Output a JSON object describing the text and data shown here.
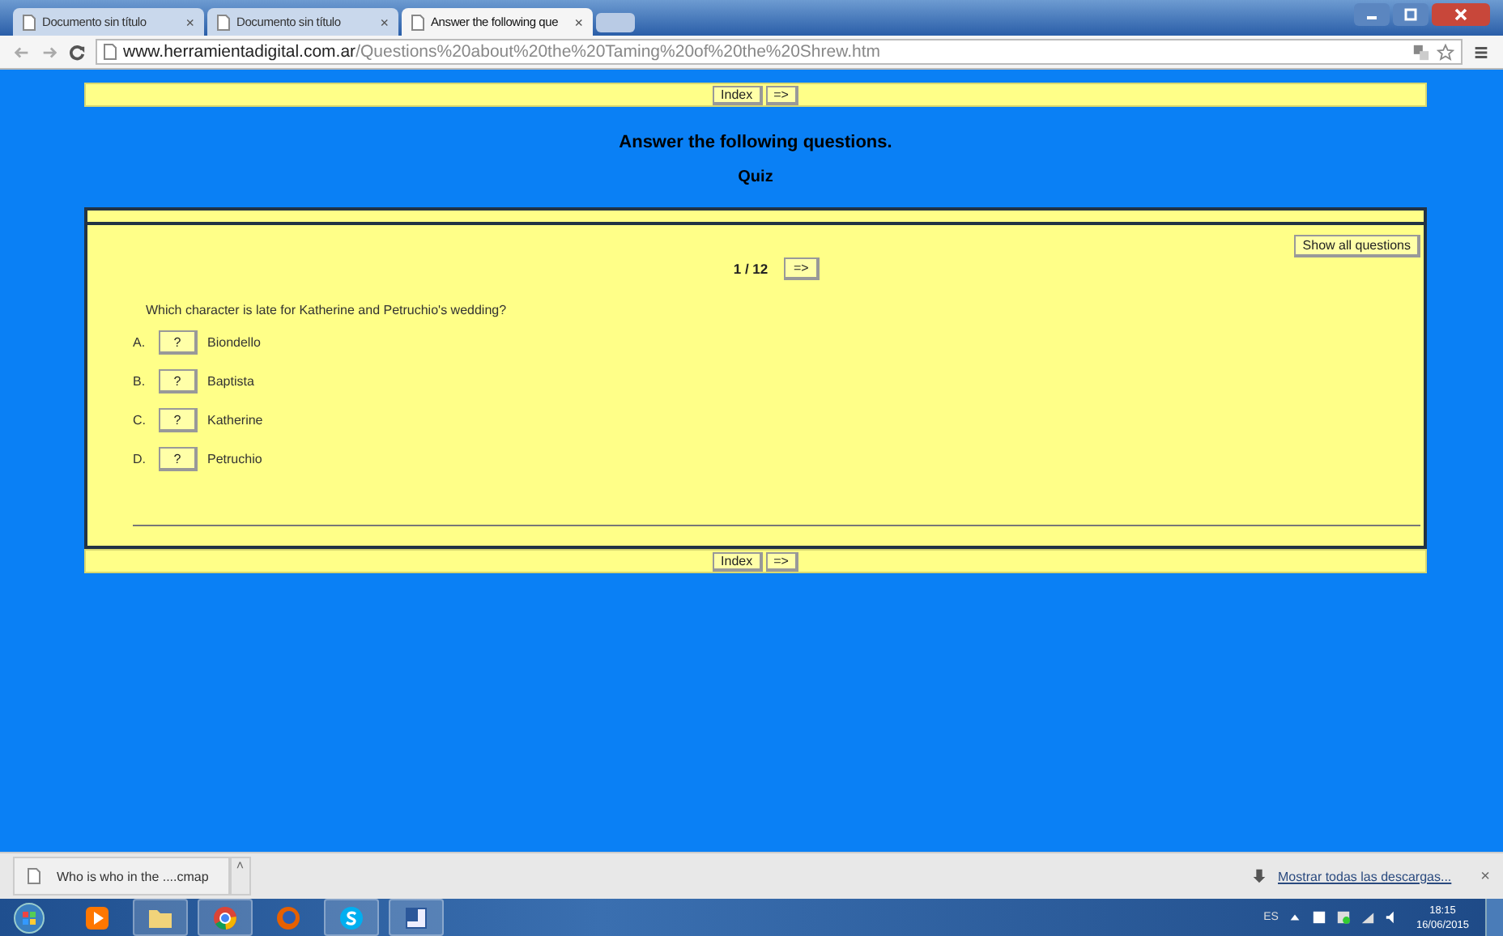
{
  "browser": {
    "tabs": [
      {
        "title": "Documento sin título",
        "close": "×",
        "selected": false
      },
      {
        "title": "Documento sin título",
        "close": "×",
        "selected": false
      },
      {
        "title": "Answer the following que",
        "close": "×",
        "selected": true
      }
    ],
    "url_host": "www.herramientadigital.com.ar",
    "url_path": "/Questions%20about%20the%20Taming%20of%20the%20Shrew.htm"
  },
  "nav_top": {
    "index": "Index",
    "next": "=>"
  },
  "heading": "Answer the following questions.",
  "subheading": "Quiz",
  "quiz": {
    "show_all": "Show all questions",
    "counter": "1 / 12",
    "next": "=>",
    "question": "Which character is late for Katherine and Petruchio's wedding?",
    "answers": [
      {
        "letter": "A.",
        "hint": "?",
        "text": "Biondello"
      },
      {
        "letter": "B.",
        "hint": "?",
        "text": "Baptista"
      },
      {
        "letter": "C.",
        "hint": "?",
        "text": "Katherine"
      },
      {
        "letter": "D.",
        "hint": "?",
        "text": "Petruchio"
      }
    ]
  },
  "nav_bottom": {
    "index": "Index",
    "next": "=>"
  },
  "download_bar": {
    "file": "Who is who in the ....cmap",
    "caret": "˄",
    "show_all": "Mostrar todas las descargas...",
    "close": "×"
  },
  "taskbar": {
    "language": "ES",
    "time": "18:15",
    "date": "16/06/2015"
  }
}
